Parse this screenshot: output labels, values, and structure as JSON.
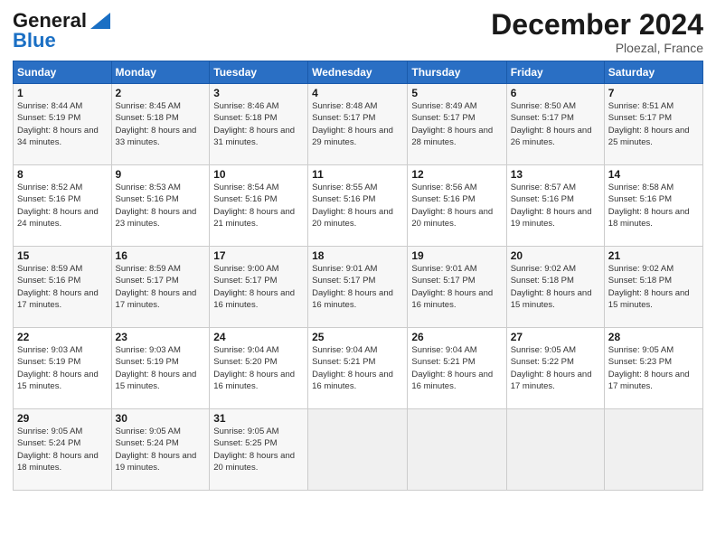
{
  "header": {
    "logo_general": "General",
    "logo_blue": "Blue",
    "month_title": "December 2024",
    "location": "Ploezal, France"
  },
  "days_of_week": [
    "Sunday",
    "Monday",
    "Tuesday",
    "Wednesday",
    "Thursday",
    "Friday",
    "Saturday"
  ],
  "weeks": [
    [
      {
        "day": "1",
        "sunrise": "Sunrise: 8:44 AM",
        "sunset": "Sunset: 5:19 PM",
        "daylight": "Daylight: 8 hours and 34 minutes."
      },
      {
        "day": "2",
        "sunrise": "Sunrise: 8:45 AM",
        "sunset": "Sunset: 5:18 PM",
        "daylight": "Daylight: 8 hours and 33 minutes."
      },
      {
        "day": "3",
        "sunrise": "Sunrise: 8:46 AM",
        "sunset": "Sunset: 5:18 PM",
        "daylight": "Daylight: 8 hours and 31 minutes."
      },
      {
        "day": "4",
        "sunrise": "Sunrise: 8:48 AM",
        "sunset": "Sunset: 5:17 PM",
        "daylight": "Daylight: 8 hours and 29 minutes."
      },
      {
        "day": "5",
        "sunrise": "Sunrise: 8:49 AM",
        "sunset": "Sunset: 5:17 PM",
        "daylight": "Daylight: 8 hours and 28 minutes."
      },
      {
        "day": "6",
        "sunrise": "Sunrise: 8:50 AM",
        "sunset": "Sunset: 5:17 PM",
        "daylight": "Daylight: 8 hours and 26 minutes."
      },
      {
        "day": "7",
        "sunrise": "Sunrise: 8:51 AM",
        "sunset": "Sunset: 5:17 PM",
        "daylight": "Daylight: 8 hours and 25 minutes."
      }
    ],
    [
      {
        "day": "8",
        "sunrise": "Sunrise: 8:52 AM",
        "sunset": "Sunset: 5:16 PM",
        "daylight": "Daylight: 8 hours and 24 minutes."
      },
      {
        "day": "9",
        "sunrise": "Sunrise: 8:53 AM",
        "sunset": "Sunset: 5:16 PM",
        "daylight": "Daylight: 8 hours and 23 minutes."
      },
      {
        "day": "10",
        "sunrise": "Sunrise: 8:54 AM",
        "sunset": "Sunset: 5:16 PM",
        "daylight": "Daylight: 8 hours and 21 minutes."
      },
      {
        "day": "11",
        "sunrise": "Sunrise: 8:55 AM",
        "sunset": "Sunset: 5:16 PM",
        "daylight": "Daylight: 8 hours and 20 minutes."
      },
      {
        "day": "12",
        "sunrise": "Sunrise: 8:56 AM",
        "sunset": "Sunset: 5:16 PM",
        "daylight": "Daylight: 8 hours and 20 minutes."
      },
      {
        "day": "13",
        "sunrise": "Sunrise: 8:57 AM",
        "sunset": "Sunset: 5:16 PM",
        "daylight": "Daylight: 8 hours and 19 minutes."
      },
      {
        "day": "14",
        "sunrise": "Sunrise: 8:58 AM",
        "sunset": "Sunset: 5:16 PM",
        "daylight": "Daylight: 8 hours and 18 minutes."
      }
    ],
    [
      {
        "day": "15",
        "sunrise": "Sunrise: 8:59 AM",
        "sunset": "Sunset: 5:16 PM",
        "daylight": "Daylight: 8 hours and 17 minutes."
      },
      {
        "day": "16",
        "sunrise": "Sunrise: 8:59 AM",
        "sunset": "Sunset: 5:17 PM",
        "daylight": "Daylight: 8 hours and 17 minutes."
      },
      {
        "day": "17",
        "sunrise": "Sunrise: 9:00 AM",
        "sunset": "Sunset: 5:17 PM",
        "daylight": "Daylight: 8 hours and 16 minutes."
      },
      {
        "day": "18",
        "sunrise": "Sunrise: 9:01 AM",
        "sunset": "Sunset: 5:17 PM",
        "daylight": "Daylight: 8 hours and 16 minutes."
      },
      {
        "day": "19",
        "sunrise": "Sunrise: 9:01 AM",
        "sunset": "Sunset: 5:17 PM",
        "daylight": "Daylight: 8 hours and 16 minutes."
      },
      {
        "day": "20",
        "sunrise": "Sunrise: 9:02 AM",
        "sunset": "Sunset: 5:18 PM",
        "daylight": "Daylight: 8 hours and 15 minutes."
      },
      {
        "day": "21",
        "sunrise": "Sunrise: 9:02 AM",
        "sunset": "Sunset: 5:18 PM",
        "daylight": "Daylight: 8 hours and 15 minutes."
      }
    ],
    [
      {
        "day": "22",
        "sunrise": "Sunrise: 9:03 AM",
        "sunset": "Sunset: 5:19 PM",
        "daylight": "Daylight: 8 hours and 15 minutes."
      },
      {
        "day": "23",
        "sunrise": "Sunrise: 9:03 AM",
        "sunset": "Sunset: 5:19 PM",
        "daylight": "Daylight: 8 hours and 15 minutes."
      },
      {
        "day": "24",
        "sunrise": "Sunrise: 9:04 AM",
        "sunset": "Sunset: 5:20 PM",
        "daylight": "Daylight: 8 hours and 16 minutes."
      },
      {
        "day": "25",
        "sunrise": "Sunrise: 9:04 AM",
        "sunset": "Sunset: 5:21 PM",
        "daylight": "Daylight: 8 hours and 16 minutes."
      },
      {
        "day": "26",
        "sunrise": "Sunrise: 9:04 AM",
        "sunset": "Sunset: 5:21 PM",
        "daylight": "Daylight: 8 hours and 16 minutes."
      },
      {
        "day": "27",
        "sunrise": "Sunrise: 9:05 AM",
        "sunset": "Sunset: 5:22 PM",
        "daylight": "Daylight: 8 hours and 17 minutes."
      },
      {
        "day": "28",
        "sunrise": "Sunrise: 9:05 AM",
        "sunset": "Sunset: 5:23 PM",
        "daylight": "Daylight: 8 hours and 17 minutes."
      }
    ],
    [
      {
        "day": "29",
        "sunrise": "Sunrise: 9:05 AM",
        "sunset": "Sunset: 5:24 PM",
        "daylight": "Daylight: 8 hours and 18 minutes."
      },
      {
        "day": "30",
        "sunrise": "Sunrise: 9:05 AM",
        "sunset": "Sunset: 5:24 PM",
        "daylight": "Daylight: 8 hours and 19 minutes."
      },
      {
        "day": "31",
        "sunrise": "Sunrise: 9:05 AM",
        "sunset": "Sunset: 5:25 PM",
        "daylight": "Daylight: 8 hours and 20 minutes."
      },
      null,
      null,
      null,
      null
    ]
  ]
}
